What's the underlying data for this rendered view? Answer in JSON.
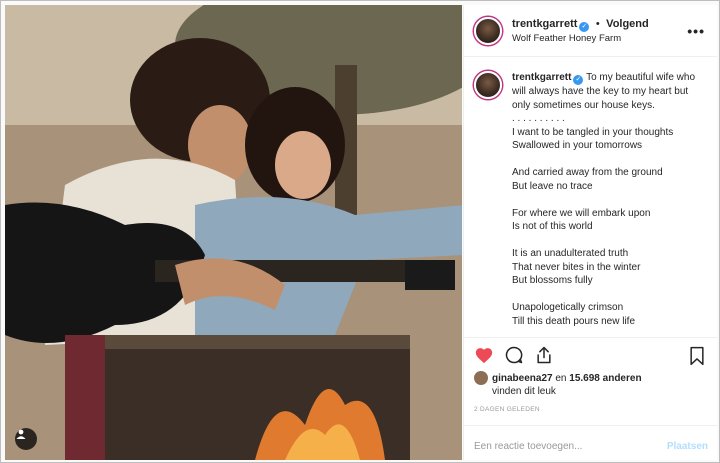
{
  "post": {
    "username": "trentkgarrett",
    "verified_glyph": "✓",
    "separator": "•",
    "follow_label": "Volgend",
    "location": "Wolf Feather Honey Farm",
    "more_label": "•••"
  },
  "caption": {
    "username": "trentkgarrett",
    "lines": [
      "To my beautiful wife who",
      "will always have the key to my heart but",
      "only sometimes our house keys.",
      ". . . . . . . . . .",
      "I want to be tangled in your thoughts",
      "Swallowed in your tomorrows",
      "",
      "And carried away from the ground",
      "But leave no trace",
      "",
      "For where we will embark upon",
      "Is not of this world",
      "",
      "It is an unadulterated truth",
      "That never bites in the winter",
      "But blossoms fully",
      "",
      "Unapologetically crimson",
      "Till this death pours new life"
    ]
  },
  "icons": {
    "like": "heart-icon",
    "comment": "comment-icon",
    "share": "share-icon",
    "save": "bookmark-icon",
    "user_tag": "user-tag-icon",
    "more": "more-options-icon"
  },
  "colors": {
    "heart": "#ed4956",
    "verified": "#3897f0",
    "post_button": "#b2dffc"
  },
  "likes": {
    "liker": "ginabeena27",
    "connector": "en",
    "count_text": "15.698 anderen",
    "suffix": "vinden dit leuk"
  },
  "timestamp": "2 DAGEN GELEDEN",
  "comment": {
    "placeholder": "Een reactie toevoegen...",
    "post_label": "Plaatsen"
  }
}
